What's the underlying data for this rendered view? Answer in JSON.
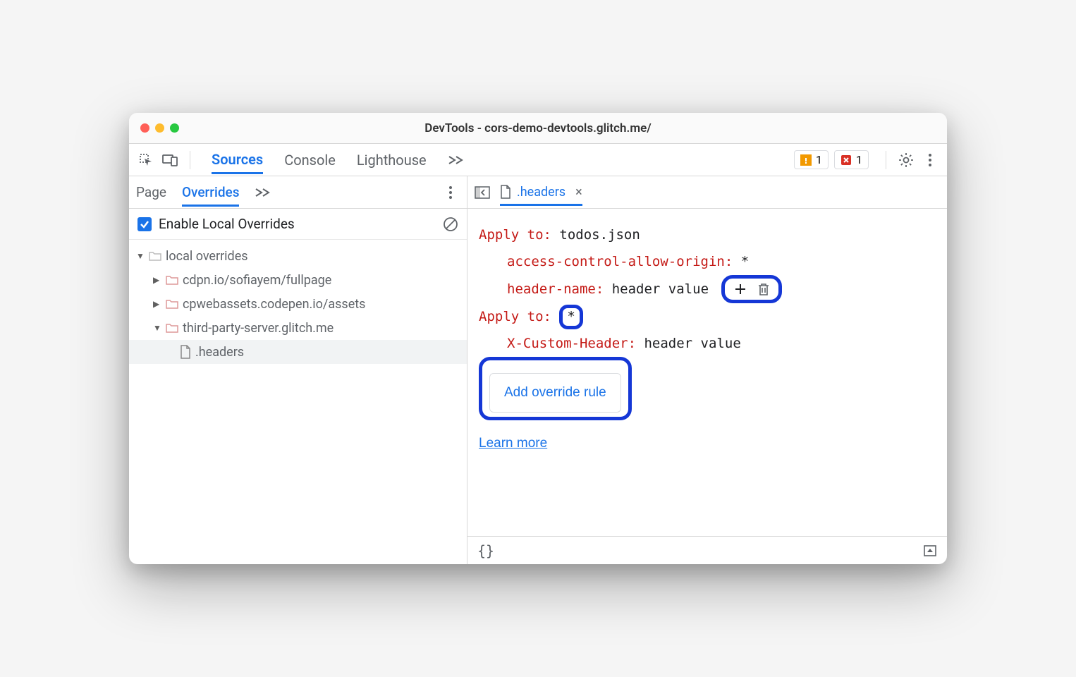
{
  "window": {
    "title": "DevTools - cors-demo-devtools.glitch.me/"
  },
  "toolbar": {
    "tabs": [
      "Sources",
      "Console",
      "Lighthouse"
    ],
    "warnings_count": "1",
    "errors_count": "1"
  },
  "sidebar": {
    "subtabs": [
      "Page",
      "Overrides"
    ],
    "enable_label": "Enable Local Overrides",
    "tree": {
      "root": "local overrides",
      "folders": [
        "cdpn.io/sofiayem/fullpage",
        "cpwebassets.codepen.io/assets",
        "third-party-server.glitch.me"
      ],
      "file": ".headers"
    }
  },
  "editor": {
    "tab_name": ".headers",
    "rules": [
      {
        "apply_label": "Apply to",
        "apply_value": "todos.json",
        "headers": [
          {
            "name": "access-control-allow-origin",
            "value": "*"
          },
          {
            "name": "header-name",
            "value": "header value"
          }
        ]
      },
      {
        "apply_label": "Apply to",
        "apply_value": "*",
        "headers": [
          {
            "name": "X-Custom-Header",
            "value": "header value"
          }
        ]
      }
    ],
    "add_rule_label": "Add override rule",
    "learn_more_label": "Learn more"
  },
  "statusbar": {
    "format_label": "{}"
  }
}
